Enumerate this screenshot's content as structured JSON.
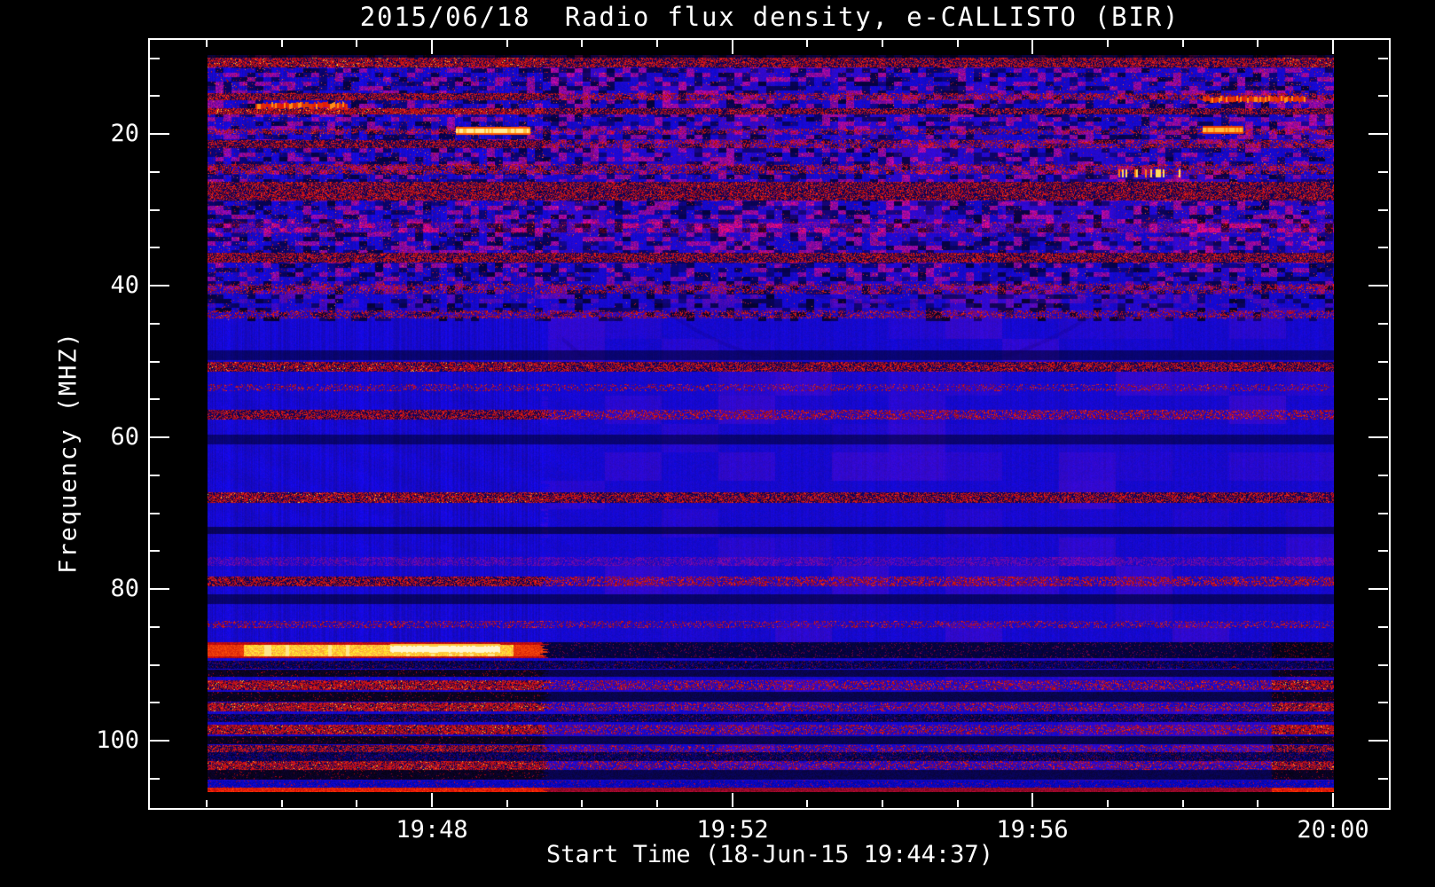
{
  "title": "2015/06/18  Radio flux density, e-CALLISTO (BIR)",
  "axes": {
    "x": {
      "label": "Start Time (18-Jun-15 19:44:37)",
      "tick_labels": [
        "19:48",
        "19:52",
        "19:56",
        "20:00"
      ],
      "minor_ticks_total": 16,
      "minor_interval": "1 minute"
    },
    "y": {
      "label": "Frequency (MHZ)",
      "tick_labels": [
        "20",
        "40",
        "60",
        "80",
        "100"
      ],
      "minor_step_mhz": 5
    }
  },
  "chart_data": {
    "type": "heatmap",
    "title": "2015/06/18  Radio flux density, e-CALLISTO (BIR)",
    "xlabel": "Start Time (18-Jun-15 19:44:37)",
    "ylabel": "Frequency (MHZ)",
    "x_ticks": [
      "19:48",
      "19:52",
      "19:56",
      "20:00"
    ],
    "x_start_time": "19:44:37",
    "x_end_time": "20:00",
    "time_span_minutes": 15.4,
    "y_ticks": [
      20,
      40,
      60,
      80,
      100
    ],
    "y_range_mhz": [
      9.6,
      106.8
    ],
    "legend": "none",
    "grid": false,
    "colormap": {
      "base_blue": "#1a14d0",
      "dark_patch": "#000022",
      "maroon_haze": "#6e1256",
      "red_rfi": "#cc1400",
      "orange": "#ff6a00",
      "yellow": "#ffd24a",
      "white_hot": "#fff3c8"
    },
    "rfi_transition_minute": 4.62,
    "right_rfi_start_minute": 14.55,
    "mottle_top_mhz_limit": 38,
    "bands": [
      [
        9.95,
        11.1,
        "rd",
        [
          0.8,
          0.6,
          0.7
        ]
      ],
      [
        14.6,
        15.4,
        "rd",
        [
          0.6,
          0.4,
          0.45
        ]
      ],
      [
        16.6,
        17.3,
        "rd",
        [
          0.95,
          0.5,
          0.6
        ]
      ],
      [
        19.3,
        19.9,
        "rd",
        [
          0.35,
          0.2,
          0.45
        ]
      ],
      [
        20.8,
        21.8,
        "rd",
        [
          0.5,
          0.35,
          0.4
        ]
      ],
      [
        24.0,
        25.2,
        "rd",
        [
          0.45,
          0.3,
          0.35
        ]
      ],
      [
        26.3,
        28.7,
        "rd",
        [
          0.6,
          0.5,
          0.5
        ]
      ],
      [
        31.6,
        33.0,
        "mr",
        [
          0.5,
          0.5,
          0.5
        ]
      ],
      [
        35.7,
        36.9,
        "rd",
        [
          0.6,
          0.55,
          0.6
        ]
      ],
      [
        39.8,
        40.9,
        "rd",
        [
          0.2,
          0.2,
          0.3
        ]
      ],
      [
        43.3,
        44.2,
        "rd",
        [
          0.3,
          0.25,
          0.3
        ]
      ],
      [
        48.6,
        49.7,
        "dk",
        [
          0.35,
          0.35,
          0.35
        ]
      ],
      [
        50.1,
        51.2,
        "rd",
        [
          0.7,
          0.55,
          0.55
        ]
      ],
      [
        53.0,
        53.8,
        "rd",
        [
          0.1,
          0.07,
          0.07
        ]
      ],
      [
        56.4,
        57.6,
        "rd",
        [
          0.55,
          0.4,
          0.35
        ]
      ],
      [
        59.7,
        60.8,
        "dk",
        [
          0.3,
          0.3,
          0.3
        ]
      ],
      [
        67.3,
        68.5,
        "rd",
        [
          0.7,
          0.55,
          0.5
        ]
      ],
      [
        71.8,
        72.6,
        "dk",
        [
          0.85,
          0.85,
          0.85
        ]
      ],
      [
        75.8,
        76.9,
        "mr",
        [
          0.3,
          0.3,
          0.3
        ]
      ],
      [
        78.4,
        79.5,
        "rd",
        [
          0.6,
          0.45,
          0.45
        ]
      ],
      [
        80.7,
        81.9,
        "dk",
        [
          0.55,
          0.5,
          0.5
        ]
      ],
      [
        84.2,
        85.1,
        "rd",
        [
          0.25,
          0.15,
          0.2
        ]
      ],
      [
        87.0,
        89.0,
        "fm",
        [
          1.0,
          0.5,
          0.9
        ]
      ],
      [
        89.5,
        90.4,
        "ds",
        [
          0.7,
          0.5,
          0.85
        ]
      ],
      [
        90.6,
        91.5,
        "bk",
        [
          0.85,
          0.4,
          0.8
        ]
      ],
      [
        92.1,
        93.2,
        "rd",
        [
          0.85,
          0.3,
          0.8
        ]
      ],
      [
        93.6,
        94.7,
        "bk",
        [
          0.9,
          0.45,
          0.9
        ]
      ],
      [
        95.0,
        96.0,
        "rd",
        [
          0.9,
          0.25,
          0.85
        ]
      ],
      [
        96.5,
        97.4,
        "ds",
        [
          0.6,
          0.4,
          0.6
        ]
      ],
      [
        97.9,
        99.1,
        "rd",
        [
          0.9,
          0.3,
          1.0
        ]
      ],
      [
        99.4,
        100.4,
        "bk",
        [
          0.95,
          0.5,
          0.95
        ]
      ],
      [
        100.6,
        101.4,
        "rd",
        [
          0.6,
          0.2,
          0.5
        ]
      ],
      [
        101.5,
        102.6,
        "ds",
        [
          0.6,
          0.4,
          0.6
        ]
      ],
      [
        102.7,
        103.8,
        "rd",
        [
          0.85,
          0.25,
          0.8
        ]
      ],
      [
        103.9,
        105.0,
        "bk",
        [
          0.9,
          0.5,
          0.9
        ]
      ],
      [
        105.3,
        106.1,
        "bs",
        [
          0.5,
          0.4,
          0.5
        ]
      ],
      [
        106.2,
        106.8,
        "rl",
        [
          0.95,
          0.5,
          0.9
        ]
      ]
    ],
    "streaks": [
      [
        0.66,
        1.9,
        16.2,
        "red"
      ],
      [
        3.4,
        4.4,
        19.6,
        "yellow"
      ],
      [
        2.5,
        4.0,
        87.8,
        "hot"
      ],
      [
        12.45,
        13.3,
        25.1,
        "dashes"
      ],
      [
        13.6,
        15.0,
        15.3,
        "red"
      ],
      [
        13.6,
        14.15,
        19.4,
        "orange"
      ]
    ],
    "seed": 13
  }
}
